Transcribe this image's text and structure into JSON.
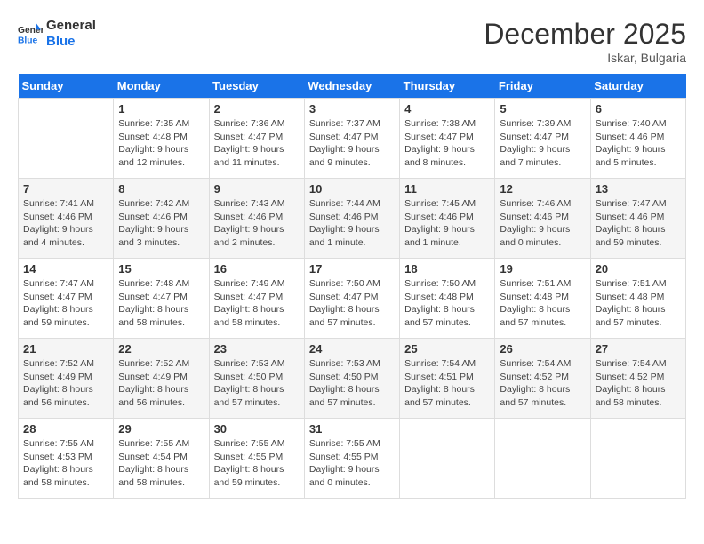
{
  "header": {
    "logo_line1": "General",
    "logo_line2": "Blue",
    "month": "December 2025",
    "location": "Iskar, Bulgaria"
  },
  "weekdays": [
    "Sunday",
    "Monday",
    "Tuesday",
    "Wednesday",
    "Thursday",
    "Friday",
    "Saturday"
  ],
  "weeks": [
    [
      {
        "day": "",
        "info": ""
      },
      {
        "day": "1",
        "info": "Sunrise: 7:35 AM\nSunset: 4:48 PM\nDaylight: 9 hours\nand 12 minutes."
      },
      {
        "day": "2",
        "info": "Sunrise: 7:36 AM\nSunset: 4:47 PM\nDaylight: 9 hours\nand 11 minutes."
      },
      {
        "day": "3",
        "info": "Sunrise: 7:37 AM\nSunset: 4:47 PM\nDaylight: 9 hours\nand 9 minutes."
      },
      {
        "day": "4",
        "info": "Sunrise: 7:38 AM\nSunset: 4:47 PM\nDaylight: 9 hours\nand 8 minutes."
      },
      {
        "day": "5",
        "info": "Sunrise: 7:39 AM\nSunset: 4:47 PM\nDaylight: 9 hours\nand 7 minutes."
      },
      {
        "day": "6",
        "info": "Sunrise: 7:40 AM\nSunset: 4:46 PM\nDaylight: 9 hours\nand 5 minutes."
      }
    ],
    [
      {
        "day": "7",
        "info": "Sunrise: 7:41 AM\nSunset: 4:46 PM\nDaylight: 9 hours\nand 4 minutes."
      },
      {
        "day": "8",
        "info": "Sunrise: 7:42 AM\nSunset: 4:46 PM\nDaylight: 9 hours\nand 3 minutes."
      },
      {
        "day": "9",
        "info": "Sunrise: 7:43 AM\nSunset: 4:46 PM\nDaylight: 9 hours\nand 2 minutes."
      },
      {
        "day": "10",
        "info": "Sunrise: 7:44 AM\nSunset: 4:46 PM\nDaylight: 9 hours\nand 1 minute."
      },
      {
        "day": "11",
        "info": "Sunrise: 7:45 AM\nSunset: 4:46 PM\nDaylight: 9 hours\nand 1 minute."
      },
      {
        "day": "12",
        "info": "Sunrise: 7:46 AM\nSunset: 4:46 PM\nDaylight: 9 hours\nand 0 minutes."
      },
      {
        "day": "13",
        "info": "Sunrise: 7:47 AM\nSunset: 4:46 PM\nDaylight: 8 hours\nand 59 minutes."
      }
    ],
    [
      {
        "day": "14",
        "info": "Sunrise: 7:47 AM\nSunset: 4:47 PM\nDaylight: 8 hours\nand 59 minutes."
      },
      {
        "day": "15",
        "info": "Sunrise: 7:48 AM\nSunset: 4:47 PM\nDaylight: 8 hours\nand 58 minutes."
      },
      {
        "day": "16",
        "info": "Sunrise: 7:49 AM\nSunset: 4:47 PM\nDaylight: 8 hours\nand 58 minutes."
      },
      {
        "day": "17",
        "info": "Sunrise: 7:50 AM\nSunset: 4:47 PM\nDaylight: 8 hours\nand 57 minutes."
      },
      {
        "day": "18",
        "info": "Sunrise: 7:50 AM\nSunset: 4:48 PM\nDaylight: 8 hours\nand 57 minutes."
      },
      {
        "day": "19",
        "info": "Sunrise: 7:51 AM\nSunset: 4:48 PM\nDaylight: 8 hours\nand 57 minutes."
      },
      {
        "day": "20",
        "info": "Sunrise: 7:51 AM\nSunset: 4:48 PM\nDaylight: 8 hours\nand 57 minutes."
      }
    ],
    [
      {
        "day": "21",
        "info": "Sunrise: 7:52 AM\nSunset: 4:49 PM\nDaylight: 8 hours\nand 56 minutes."
      },
      {
        "day": "22",
        "info": "Sunrise: 7:52 AM\nSunset: 4:49 PM\nDaylight: 8 hours\nand 56 minutes."
      },
      {
        "day": "23",
        "info": "Sunrise: 7:53 AM\nSunset: 4:50 PM\nDaylight: 8 hours\nand 57 minutes."
      },
      {
        "day": "24",
        "info": "Sunrise: 7:53 AM\nSunset: 4:50 PM\nDaylight: 8 hours\nand 57 minutes."
      },
      {
        "day": "25",
        "info": "Sunrise: 7:54 AM\nSunset: 4:51 PM\nDaylight: 8 hours\nand 57 minutes."
      },
      {
        "day": "26",
        "info": "Sunrise: 7:54 AM\nSunset: 4:52 PM\nDaylight: 8 hours\nand 57 minutes."
      },
      {
        "day": "27",
        "info": "Sunrise: 7:54 AM\nSunset: 4:52 PM\nDaylight: 8 hours\nand 58 minutes."
      }
    ],
    [
      {
        "day": "28",
        "info": "Sunrise: 7:55 AM\nSunset: 4:53 PM\nDaylight: 8 hours\nand 58 minutes."
      },
      {
        "day": "29",
        "info": "Sunrise: 7:55 AM\nSunset: 4:54 PM\nDaylight: 8 hours\nand 58 minutes."
      },
      {
        "day": "30",
        "info": "Sunrise: 7:55 AM\nSunset: 4:55 PM\nDaylight: 8 hours\nand 59 minutes."
      },
      {
        "day": "31",
        "info": "Sunrise: 7:55 AM\nSunset: 4:55 PM\nDaylight: 9 hours\nand 0 minutes."
      },
      {
        "day": "",
        "info": ""
      },
      {
        "day": "",
        "info": ""
      },
      {
        "day": "",
        "info": ""
      }
    ]
  ]
}
